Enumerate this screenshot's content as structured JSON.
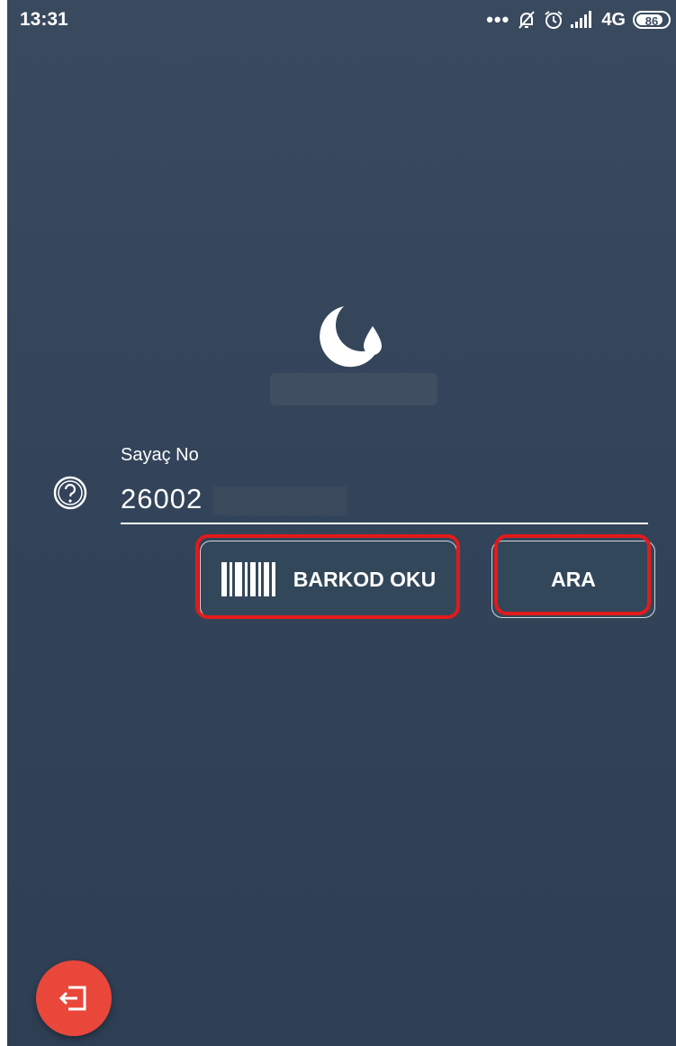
{
  "status_bar": {
    "time": "13:31",
    "dots": "•••",
    "network": "4G",
    "battery": "86",
    "battery_level": 0.86
  },
  "icons": {
    "logo": "water-drop-logo",
    "help": "question-circle-icon",
    "barcode": "barcode-icon",
    "exit": "exit-icon",
    "mute": "bell-off-icon",
    "alarm": "alarm-icon",
    "signal": "signal-icon"
  },
  "form": {
    "label": "Sayaç No",
    "value": "26002"
  },
  "buttons": {
    "barcode": "BARKOD OKU",
    "search": "ARA"
  },
  "colors": {
    "background": "#33445a",
    "highlight": "#e21b1b",
    "fab": "#e8473a"
  }
}
